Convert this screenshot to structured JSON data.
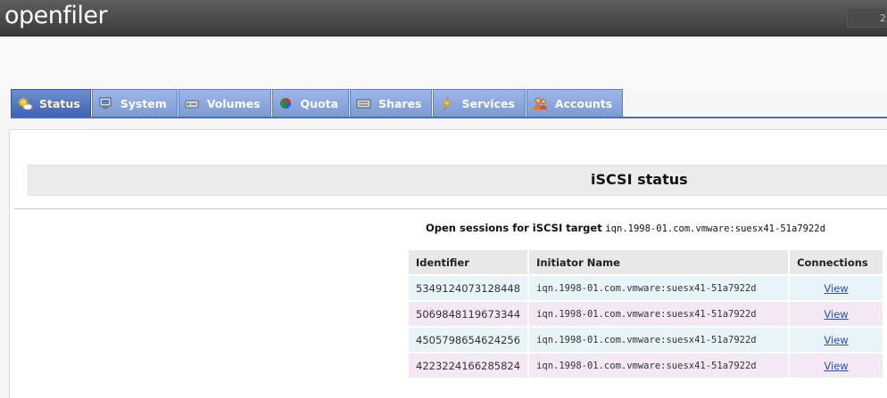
{
  "app": {
    "logo": "openfiler",
    "clock_partial": "2"
  },
  "tabs": [
    {
      "label": "Status",
      "icon": "sun-icon",
      "active": true
    },
    {
      "label": "System",
      "icon": "monitor-icon",
      "active": false
    },
    {
      "label": "Volumes",
      "icon": "disk-icon",
      "active": false
    },
    {
      "label": "Quota",
      "icon": "pie-chart-icon",
      "active": false
    },
    {
      "label": "Shares",
      "icon": "drive-icon",
      "active": false
    },
    {
      "label": "Services",
      "icon": "lightning-icon",
      "active": false
    },
    {
      "label": "Accounts",
      "icon": "users-icon",
      "active": false
    }
  ],
  "page": {
    "title": "iSCSI status",
    "caption_label": "Open sessions for iSCSI target",
    "caption_target": "iqn.1998-01.com.vmware:suesx41-51a7922d"
  },
  "table": {
    "headers": [
      "Identifier",
      "Initiator Name",
      "Connections"
    ],
    "rows": [
      {
        "id": "5349124073128448",
        "initiator": "iqn.1998-01.com.vmware:suesx41-51a7922d",
        "link": "View"
      },
      {
        "id": "5069848119673344",
        "initiator": "iqn.1998-01.com.vmware:suesx41-51a7922d",
        "link": "View"
      },
      {
        "id": "4505798654624256",
        "initiator": "iqn.1998-01.com.vmware:suesx41-51a7922d",
        "link": "View"
      },
      {
        "id": "4223224166285824",
        "initiator": "iqn.1998-01.com.vmware:suesx41-51a7922d",
        "link": "View"
      }
    ]
  },
  "colors": {
    "tab": "#86a4de",
    "tab_active": "#4a6cb8",
    "link": "#2a4fb8"
  }
}
